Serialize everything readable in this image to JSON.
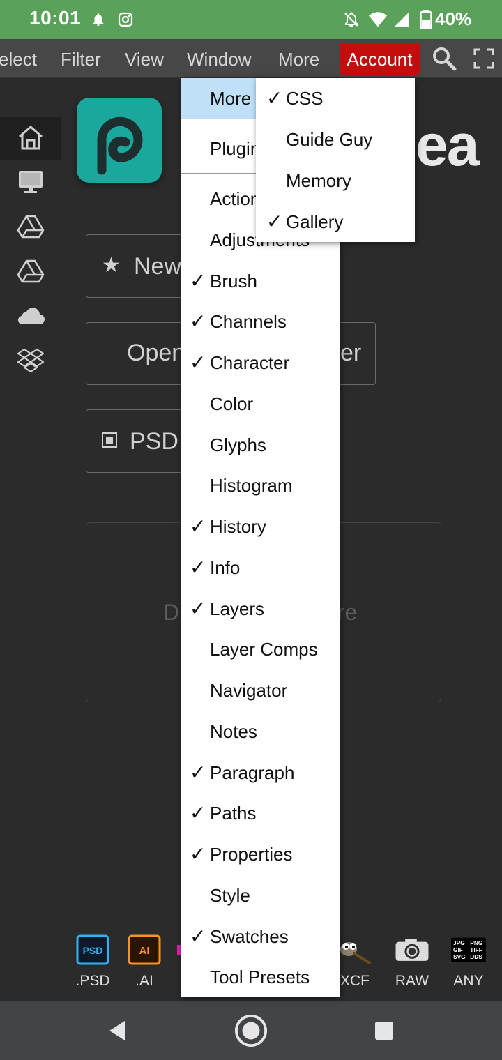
{
  "status_bar": {
    "time": "10:01",
    "battery": "40%",
    "icons": [
      "notification-bell-icon",
      "instagram-icon",
      "do-not-disturb-icon",
      "wifi-icon",
      "cell-signal-icon",
      "battery-icon"
    ]
  },
  "menubar": {
    "items": [
      "elect",
      "Filter",
      "View",
      "Window",
      "More"
    ],
    "account": "Account",
    "accent": "#c40d0d"
  },
  "sidebar": {
    "icons": [
      "home-icon",
      "monitor-icon",
      "google-drive-icon",
      "google-drive-icon",
      "onedrive-cloud-icon",
      "dropbox-icon"
    ]
  },
  "start": {
    "brand_suffix": "ea",
    "new_project": "New",
    "open_from": "Open",
    "open_from_tail": "er",
    "psd_templates": "PSD T",
    "dropzone_left": "D",
    "dropzone_right": "ere"
  },
  "formats": [
    ".PSD",
    ".AI",
    "XCF",
    "RAW",
    "ANY"
  ],
  "window_menu": {
    "items": [
      {
        "label": "More",
        "checked": false,
        "highlighted": true
      },
      {
        "label": "Plugin",
        "checked": false
      },
      {
        "label": "Actions",
        "checked": false
      },
      {
        "label": "Adjustments",
        "checked": false
      },
      {
        "label": "Brush",
        "checked": true
      },
      {
        "label": "Channels",
        "checked": true
      },
      {
        "label": "Character",
        "checked": true
      },
      {
        "label": "Color",
        "checked": false
      },
      {
        "label": "Glyphs",
        "checked": false
      },
      {
        "label": "Histogram",
        "checked": false
      },
      {
        "label": "History",
        "checked": true
      },
      {
        "label": "Info",
        "checked": true
      },
      {
        "label": "Layers",
        "checked": true
      },
      {
        "label": "Layer Comps",
        "checked": false
      },
      {
        "label": "Navigator",
        "checked": false
      },
      {
        "label": "Notes",
        "checked": false
      },
      {
        "label": "Paragraph",
        "checked": true
      },
      {
        "label": "Paths",
        "checked": true
      },
      {
        "label": "Properties",
        "checked": true
      },
      {
        "label": "Style",
        "checked": false
      },
      {
        "label": "Swatches",
        "checked": true
      },
      {
        "label": "Tool Presets",
        "checked": false
      }
    ]
  },
  "more_submenu": {
    "items": [
      {
        "label": "CSS",
        "checked": true
      },
      {
        "label": "Guide Guy",
        "checked": false
      },
      {
        "label": "Memory",
        "checked": false
      },
      {
        "label": "Gallery",
        "checked": true
      }
    ]
  },
  "check_glyph": "✓"
}
